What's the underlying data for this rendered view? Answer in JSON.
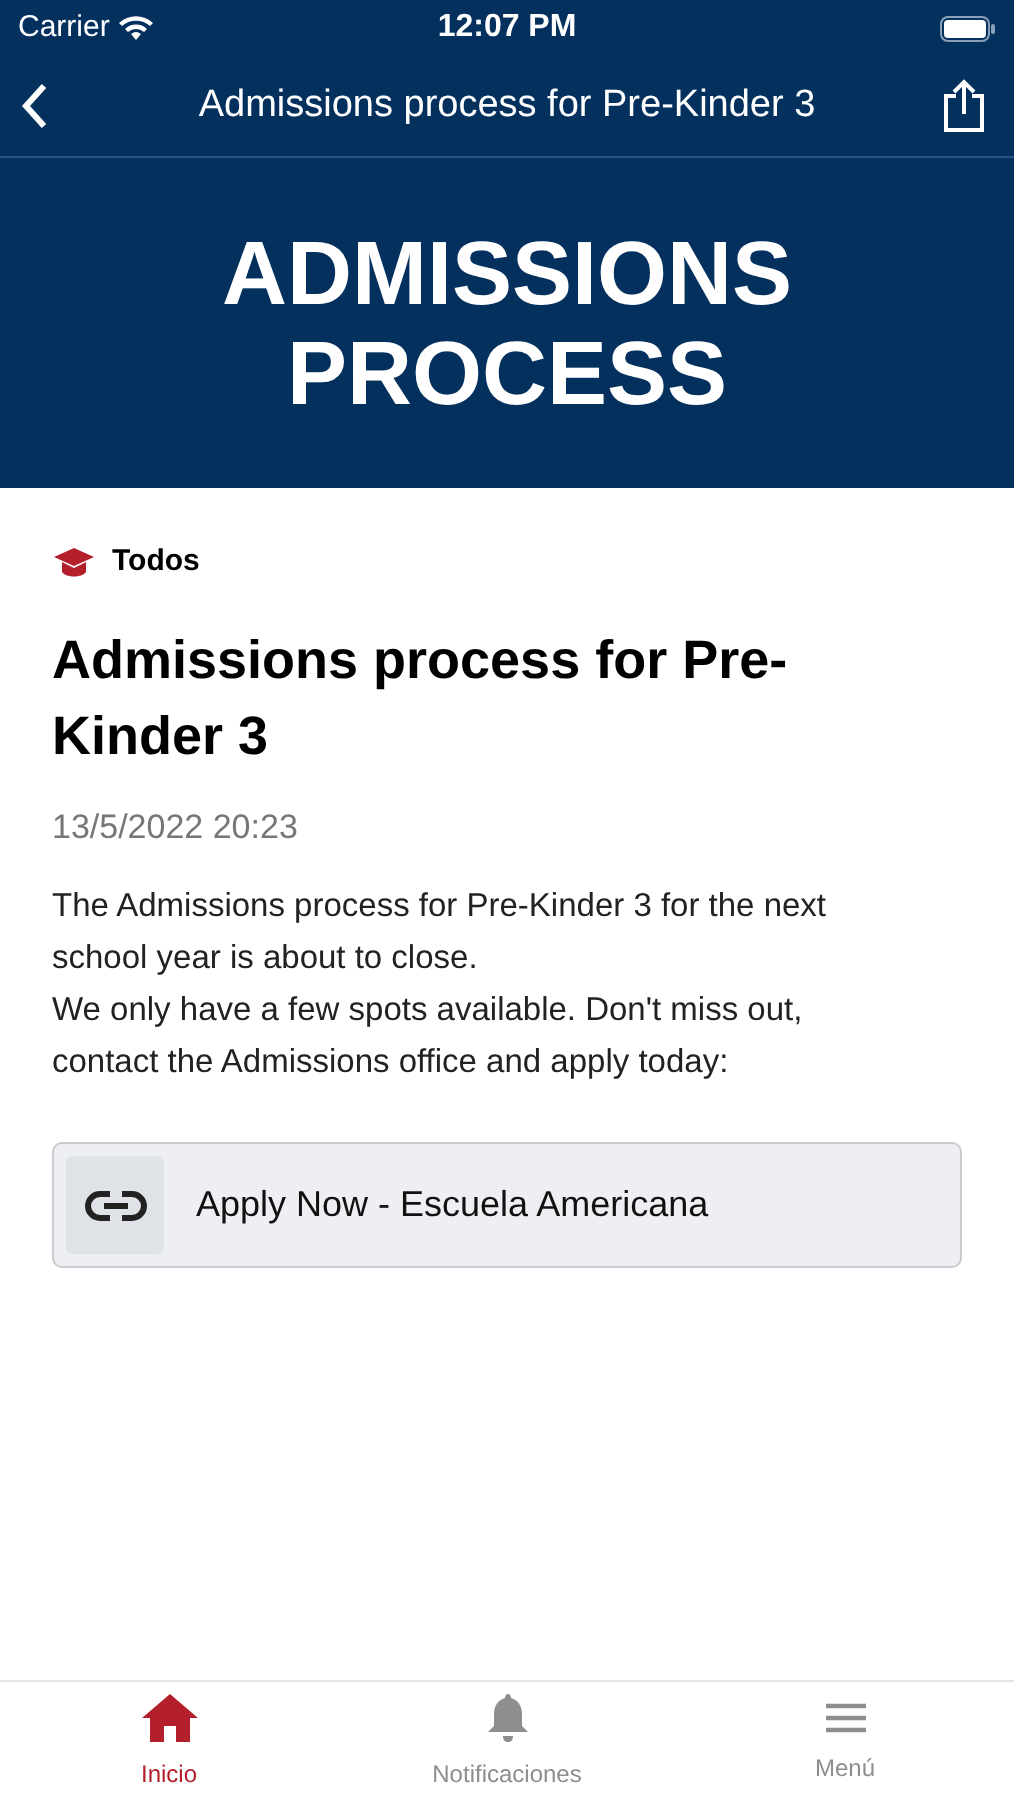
{
  "status_bar": {
    "carrier": "Carrier",
    "time": "12:07 PM"
  },
  "nav": {
    "title": "Admissions process for Pre-Kinder 3"
  },
  "banner": {
    "lines": [
      "ADMISSIONS",
      "PROCESS"
    ]
  },
  "category": {
    "label": "Todos"
  },
  "article": {
    "title": "Admissions process for Pre-Kinder 3",
    "date": "13/5/2022 20:23",
    "paragraphs": [
      "The Admissions process for Pre-Kinder 3 for the next school year is about to close.",
      "We only have a few spots available. Don't miss out, contact the Admissions office and apply today:"
    ]
  },
  "link": {
    "label": "Apply Now - Escuela Americana"
  },
  "tabs": [
    {
      "kind": "home",
      "label": "Inicio",
      "selected": true
    },
    {
      "kind": "bell",
      "label": "Notificaciones",
      "selected": false
    },
    {
      "kind": "menu",
      "label": "Menú",
      "selected": false
    }
  ]
}
